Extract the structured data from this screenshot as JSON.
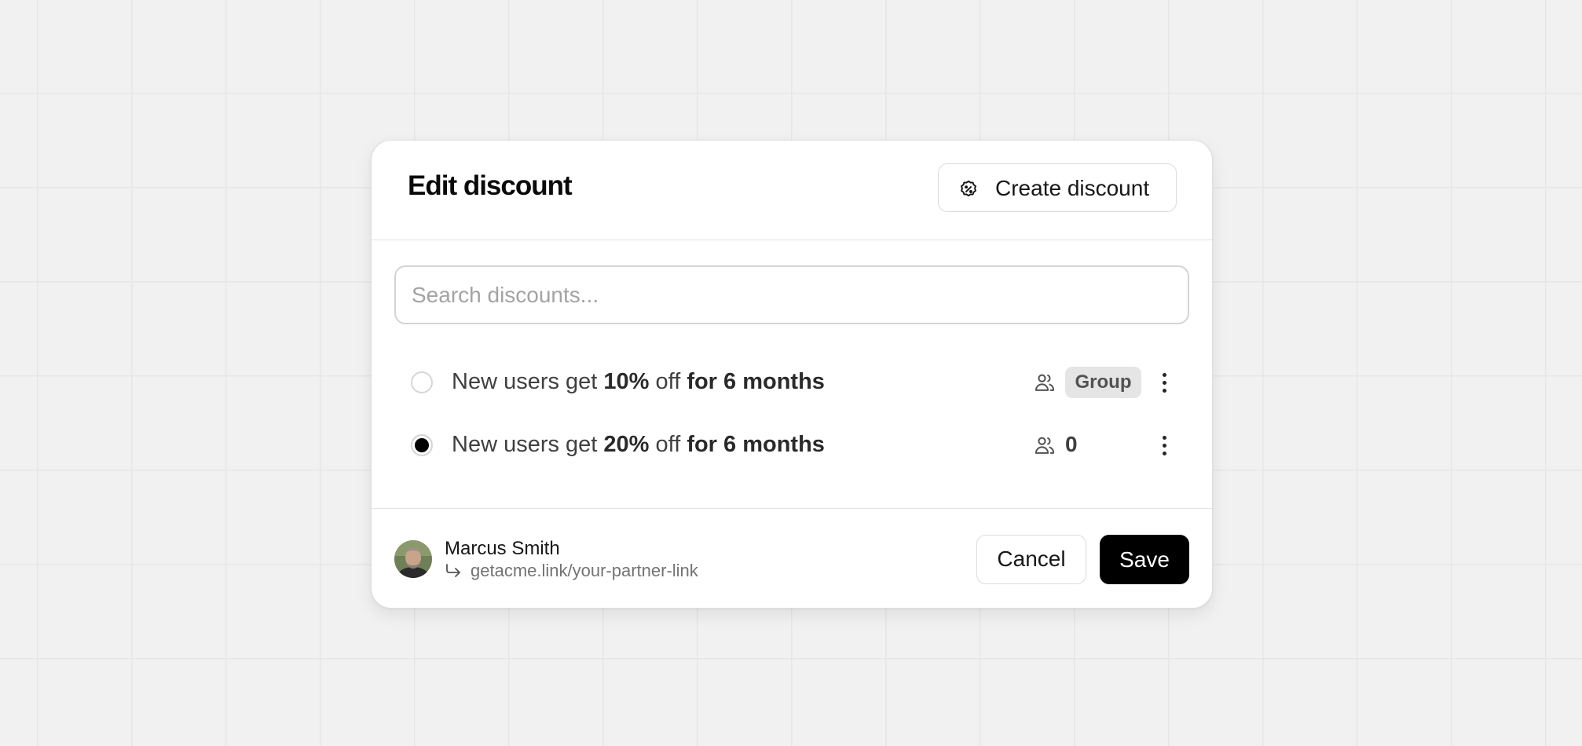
{
  "modal": {
    "title": "Edit discount",
    "create_button": {
      "label": "Create discount",
      "icon": "discount-badge-icon"
    }
  },
  "search": {
    "placeholder": "Search discounts...",
    "value": ""
  },
  "discounts": [
    {
      "selected": false,
      "text_prefix": "New users get ",
      "amount": "10%",
      "text_mid": " off ",
      "duration": "for 6 months",
      "users_icon": "users-icon",
      "badge": "Group"
    },
    {
      "selected": true,
      "text_prefix": "New users get ",
      "amount": "20%",
      "text_mid": " off ",
      "duration": "for 6 months",
      "users_icon": "users-icon",
      "count": "0"
    }
  ],
  "footer": {
    "partner_name": "Marcus Smith",
    "partner_link": "getacme.link/your-partner-link",
    "cancel_label": "Cancel",
    "save_label": "Save"
  },
  "colors": {
    "primary": "#000000",
    "background": "#f1f1f1",
    "surface": "#ffffff",
    "badge_bg": "#e5e5e5"
  }
}
